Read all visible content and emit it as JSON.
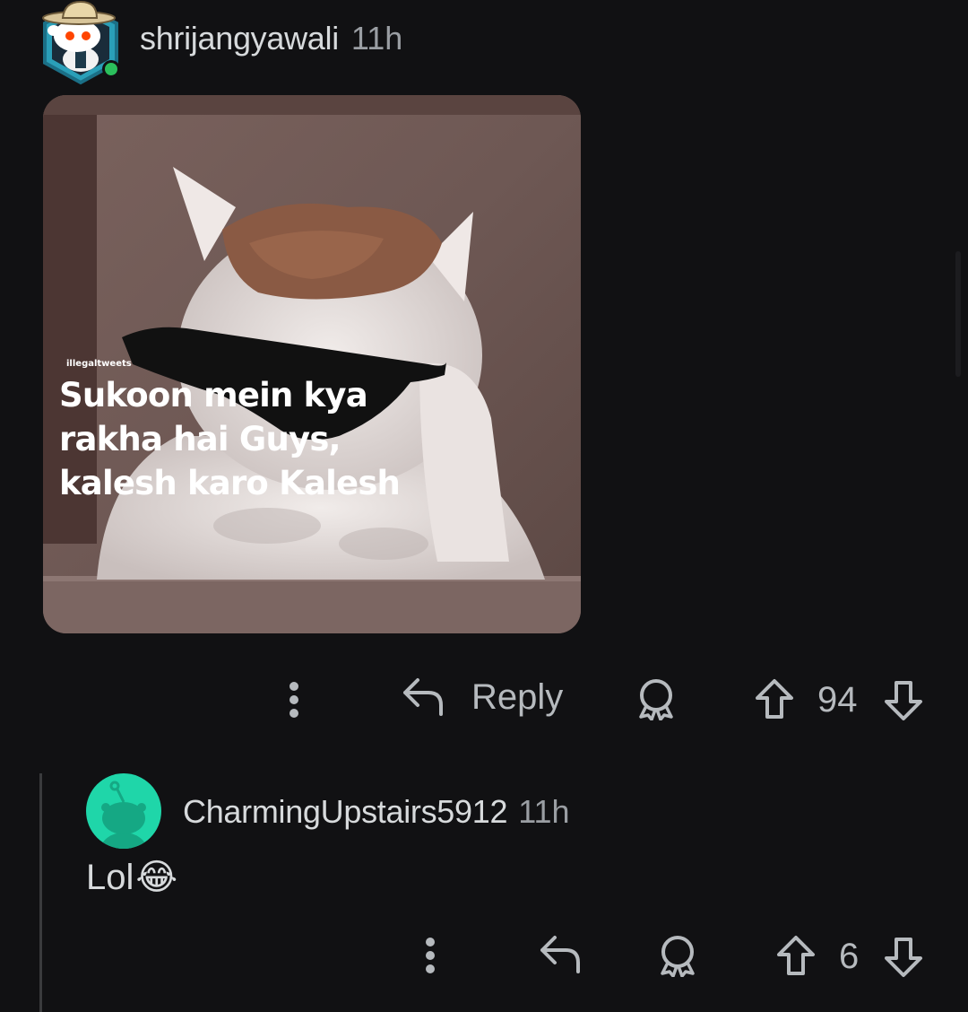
{
  "comments": [
    {
      "username": "shrijangyawali",
      "time": "11h",
      "meme": {
        "watermark": "illegaltweets",
        "caption_lines": [
          "Sukoon mein kya",
          "rakha hai Guys,",
          "kalesh karo Kalesh"
        ]
      },
      "actions": {
        "more_icon": "vertical-dots-icon",
        "reply_icon": "reply-arrow-icon",
        "reply_label": "Reply",
        "award_icon": "award-icon",
        "upvote_icon": "upvote-arrow-icon",
        "score": "94",
        "downvote_icon": "downvote-arrow-icon"
      }
    },
    {
      "username": "CharmingUpstairs5912",
      "time": "11h",
      "text": "Lol",
      "emoji": "😂",
      "actions": {
        "score": "6"
      }
    }
  ],
  "colors": {
    "background": "#111113",
    "text": "#d7dadc",
    "muted": "#9a9ea3",
    "avatar_teal": "#1fd6a9",
    "online_dot": "#2bbf5c"
  }
}
